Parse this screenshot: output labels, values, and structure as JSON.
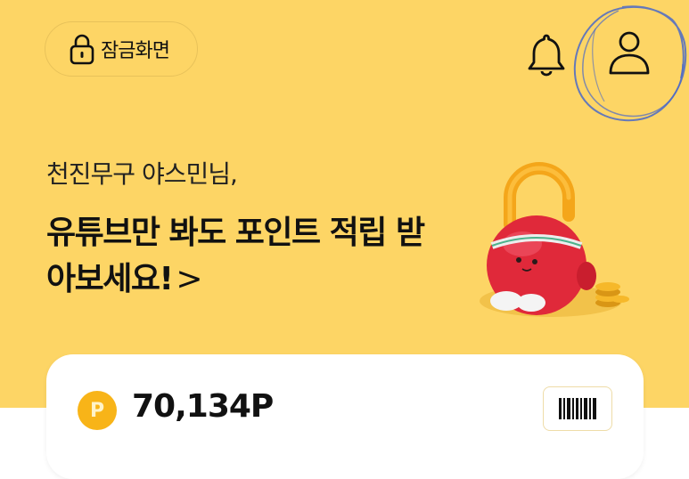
{
  "header": {
    "lock_screen_label": "잠금화면",
    "icons": {
      "lock": "lock-icon",
      "bell": "bell-icon",
      "profile": "profile-icon",
      "barcode": "barcode-icon"
    }
  },
  "hero": {
    "greeting": "천진무구 야스민님,",
    "headline": "유튜브만 봐도 포인트 적립 받아보세요!",
    "headline_arrow": ">",
    "background_color": "#FDD565"
  },
  "points_card": {
    "coin_letter": "P",
    "points_value": "70,134P",
    "coin_color": "#F8B418"
  }
}
